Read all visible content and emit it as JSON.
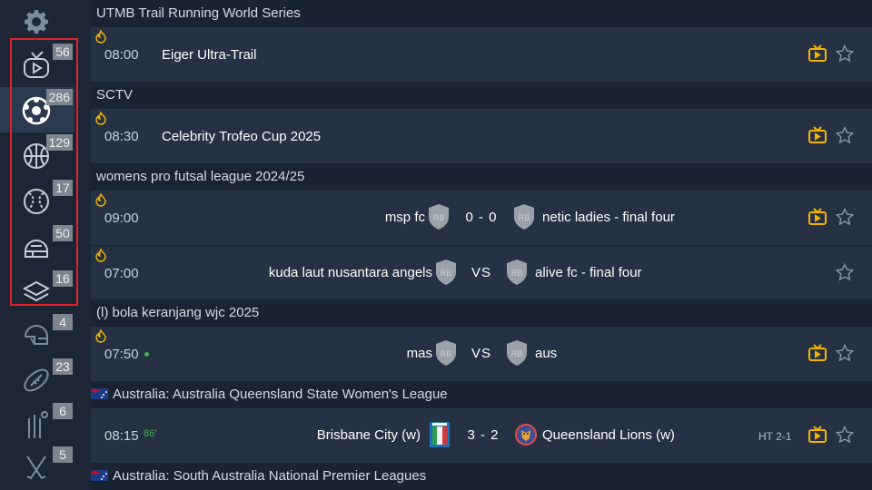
{
  "sidebar": {
    "sports": [
      {
        "icon": "tv-play-icon",
        "count": "56"
      },
      {
        "icon": "soccer-ball-icon",
        "count": "286"
      },
      {
        "icon": "basketball-icon",
        "count": "129"
      },
      {
        "icon": "baseball-icon",
        "count": "17"
      },
      {
        "icon": "hockey-helmet-icon",
        "count": "50"
      },
      {
        "icon": "layers-icon",
        "count": "16"
      },
      {
        "icon": "football-helmet-icon",
        "count": "4"
      },
      {
        "icon": "rugby-ball-icon",
        "count": "23"
      },
      {
        "icon": "cricket-icon",
        "count": "6"
      },
      {
        "icon": "hockey-sticks-icon",
        "count": "5"
      }
    ]
  },
  "leagues": [
    {
      "name": "UTMB Trail Running World Series",
      "matches": [
        {
          "time": "08:00",
          "title": "Eiger Ultra-Trail",
          "hot": true,
          "tv": true
        }
      ]
    },
    {
      "name": "SCTV",
      "matches": [
        {
          "time": "08:30",
          "title": "Celebrity Trofeo Cup 2025",
          "hot": true,
          "tv": true
        }
      ]
    },
    {
      "name": "womens pro futsal league 2024/25",
      "matches": [
        {
          "time": "09:00",
          "home": "msp fc",
          "away": "netic ladies - final four",
          "score": "0 - 0",
          "hot": true,
          "tv": true
        },
        {
          "time": "07:00",
          "home": "kuda laut nusantara angels",
          "away": "alive fc - final four",
          "score": "VS",
          "hot": true,
          "tv": false
        }
      ]
    },
    {
      "name": "(l) bola keranjang wjc 2025",
      "matches": [
        {
          "time": "07:50",
          "home": "mas",
          "away": "aus",
          "score": "VS",
          "hot": true,
          "tv": true
        }
      ]
    },
    {
      "name": "Australia: Australia Queensland State Women's League",
      "flag": "australia",
      "matches": [
        {
          "time": "08:15",
          "minute": "86'",
          "home": "Brisbane City (w)",
          "away": "Queensland Lions (w)",
          "score": "3 - 2",
          "halftime": "HT 2-1",
          "tv": true
        }
      ]
    },
    {
      "name": "Australia: South Australia National Premier Leagues",
      "flag": "australia"
    }
  ],
  "placeholder_logo_text": "RB",
  "colors": {
    "accent_yellow": "#f4b400",
    "live_green": "#3db64b",
    "highlight_red": "#e0202a"
  }
}
